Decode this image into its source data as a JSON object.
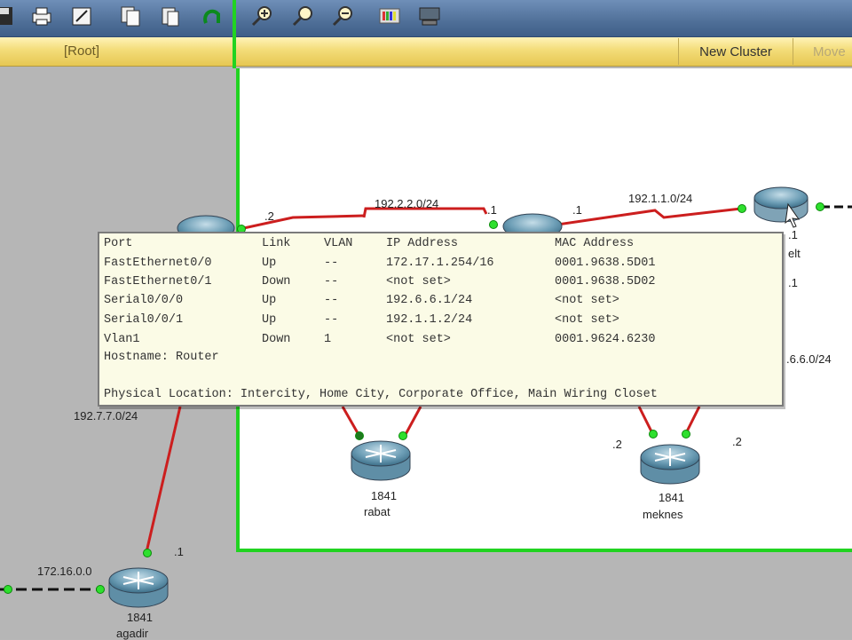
{
  "toolbar": {
    "icons": [
      "save-icon",
      "print-icon",
      "activity-wizard-icon",
      "copy-icon",
      "paste-icon",
      "undo-icon",
      "zoom-in-icon",
      "zoom-reset-icon",
      "zoom-out-icon",
      "palette-icon",
      "custom-device-icon"
    ]
  },
  "workspace": {
    "root_label": "[Root]",
    "new_cluster_label": "New Cluster",
    "move_label": "Move"
  },
  "network": {
    "labels": {
      "net_192_2_2": "192.2.2.0/24",
      "net_192_1_1": "192.1.1.0/24",
      "net_192_7_7": "192.7.7.0/24",
      "net_172_16": "172.16.0.0",
      "net_6_6": ".6.6.0/24",
      "dot2_left": ".2",
      "dot1_center_a": ".1",
      "dot1_center_b": ".1",
      "dot1_right": ".1",
      "dot1_right_b": ".1",
      "dot2_meknes_l": ".2",
      "dot2_meknes_r": ".2",
      "dot1_agadir": ".1",
      "elt_fragment": "elt"
    },
    "routers": [
      {
        "id": "rabat",
        "model": "1841",
        "name": "rabat"
      },
      {
        "id": "meknes",
        "model": "1841",
        "name": "meknes"
      },
      {
        "id": "agadir",
        "model": "1841",
        "name": "agadir"
      }
    ]
  },
  "tooltip": {
    "headers": {
      "port": "Port",
      "link": "Link",
      "vlan": "VLAN",
      "ip": "IP Address",
      "mac": "MAC Address"
    },
    "rows": [
      {
        "port": "FastEthernet0/0",
        "link": "Up",
        "vlan": "--",
        "ip": "172.17.1.254/16",
        "mac": "0001.9638.5D01"
      },
      {
        "port": "FastEthernet0/1",
        "link": "Down",
        "vlan": "--",
        "ip": "<not set>",
        "mac": "0001.9638.5D02"
      },
      {
        "port": "Serial0/0/0",
        "link": "Up",
        "vlan": "--",
        "ip": "192.6.6.1/24",
        "mac": "<not set>"
      },
      {
        "port": "Serial0/0/1",
        "link": "Up",
        "vlan": "--",
        "ip": "192.1.1.2/24",
        "mac": "<not set>"
      },
      {
        "port": "Vlan1",
        "link": "Down",
        "vlan": "1",
        "ip": "<not set>",
        "mac": "0001.9624.6230"
      }
    ],
    "hostname": "Hostname: Router",
    "location": "Physical Location: Intercity, Home City, Corporate Office, Main Wiring Closet"
  },
  "colors": {
    "cluster_border": "#21d321",
    "link_red": "#cc1e1e",
    "port_green": "#2ee02e",
    "tooltip_bg": "#fbfbe6"
  }
}
